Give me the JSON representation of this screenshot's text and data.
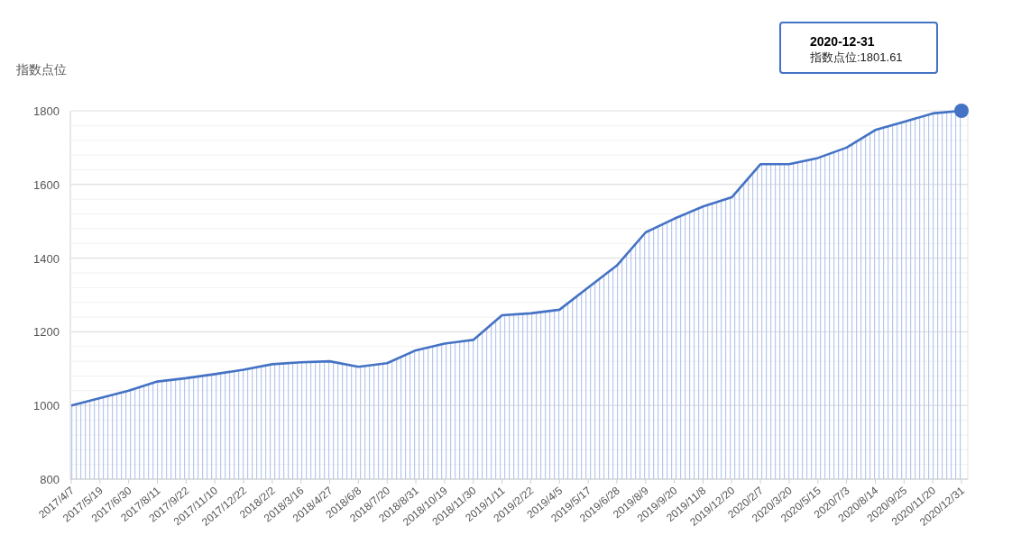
{
  "chart": {
    "chart_data": {
      "type": "area",
      "ylabel": "指数点位",
      "ylim": [
        800,
        1800
      ],
      "grid": true,
      "yticks": [
        800,
        1000,
        1200,
        1400,
        1600,
        1800
      ],
      "categories": [
        "2017/4/7",
        "2017/5/19",
        "2017/6/30",
        "2017/8/11",
        "2017/9/22",
        "2017/11/10",
        "2017/12/22",
        "2018/2/2",
        "2018/3/16",
        "2018/4/27",
        "2018/6/8",
        "2018/7/20",
        "2018/8/31",
        "2018/10/19",
        "2018/11/30",
        "2019/1/11",
        "2019/2/22",
        "2019/4/5",
        "2019/5/17",
        "2019/6/28",
        "2019/8/9",
        "2019/9/20",
        "2019/11/8",
        "2019/12/20",
        "2020/2/7",
        "2020/3/20",
        "2020/5/15",
        "2020/7/3",
        "2020/8/14",
        "2020/9/25",
        "2020/11/20",
        "2020/12/31"
      ],
      "series": [
        {
          "color": "#4472c4",
          "values": [
            1000,
            1020,
            1040,
            1065,
            1074,
            1085,
            1097,
            1112,
            1117,
            1120,
            1105,
            1115,
            1150,
            1168,
            1178,
            1245,
            1250,
            1260,
            1320,
            1380,
            1470,
            1507,
            1540,
            1565,
            1655,
            1655,
            1672,
            1700,
            1748,
            1770,
            1793,
            1800
          ]
        }
      ]
    },
    "tooltip": {
      "title": "2020-12-31",
      "text": "指数点位:1801.61"
    }
  }
}
